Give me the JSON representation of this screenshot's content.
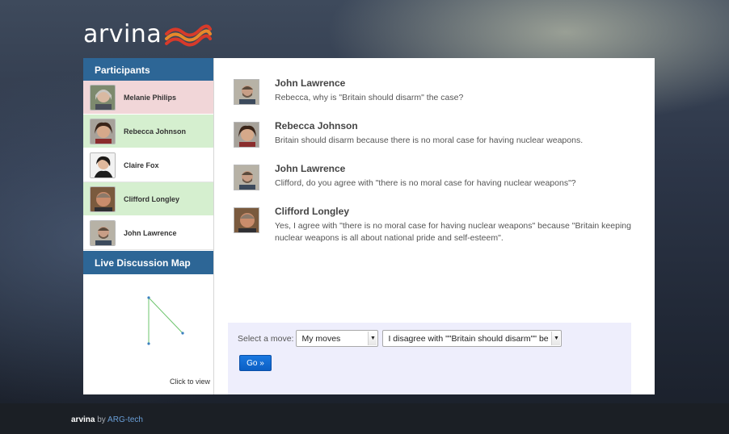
{
  "logo": {
    "text": "arvina"
  },
  "sidebar": {
    "participants_title": "Participants",
    "participants": [
      {
        "name": "Melanie Philips",
        "status": "red"
      },
      {
        "name": "Rebecca Johnson",
        "status": "green"
      },
      {
        "name": "Claire Fox",
        "status": "white"
      },
      {
        "name": "Clifford Longley",
        "status": "green"
      },
      {
        "name": "John Lawrence",
        "status": "white"
      }
    ],
    "map_title": "Live Discussion Map",
    "click_to_view": "Click to view"
  },
  "messages": [
    {
      "author": "John Lawrence",
      "text": "Rebecca, why is \"Britain should disarm\" the case?"
    },
    {
      "author": "Rebecca Johnson",
      "text": "Britain should disarm because there is no moral case for having nuclear weapons."
    },
    {
      "author": "John Lawrence",
      "text": "Clifford, do you agree with \"there is no moral case for having nuclear weapons\"?"
    },
    {
      "author": "Clifford Longley",
      "text": "Yes, I agree with \"there is no moral case for having nuclear weapons\" because \"Britain keeping nuclear weapons is all about national pride and self-esteem\"."
    }
  ],
  "moves": {
    "label": "Select a move:",
    "move_type_selected": "My moves",
    "move_selected": "I disagree with \"\"Britain should disarm\"\" be",
    "go_label": "Go »"
  },
  "footer": {
    "brand": "arvina",
    "by": "by",
    "link": "ARG-tech"
  },
  "colors": {
    "header_blue": "#2d6696",
    "participant_red": "#f1d6d8",
    "participant_green": "#d5efcf",
    "moves_bg": "#eeeefc",
    "go_button": "#1a78e0",
    "map_line": "#6cc46c",
    "map_node": "#3a7fbf"
  }
}
